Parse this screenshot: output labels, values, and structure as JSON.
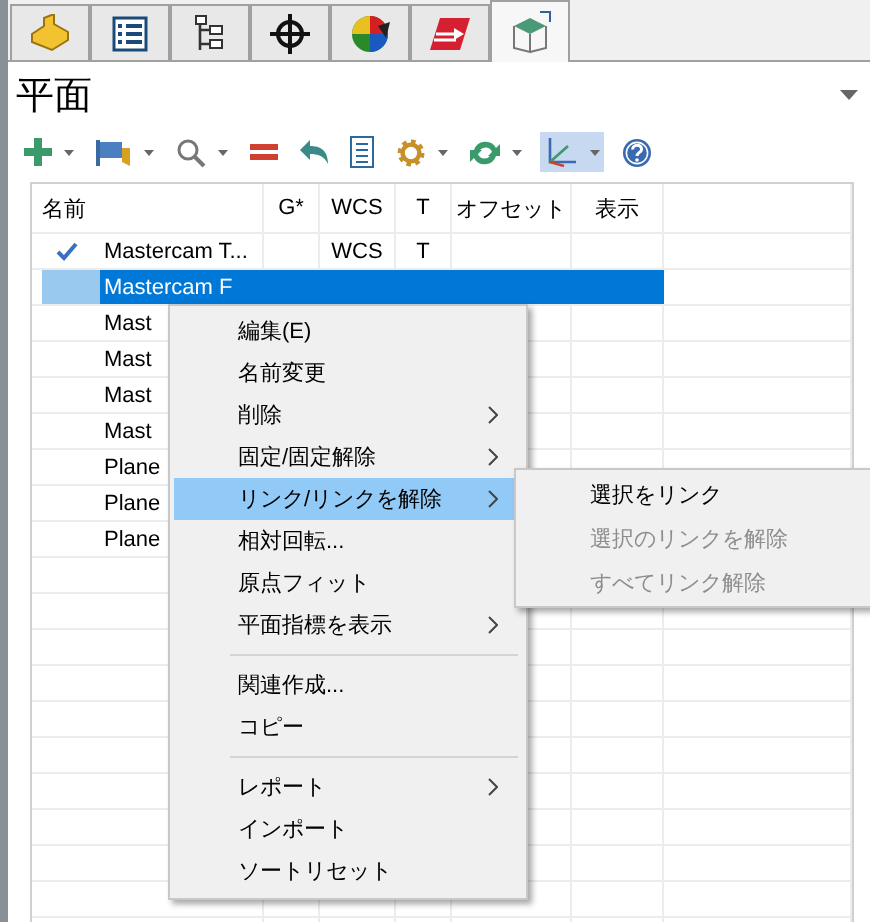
{
  "tabs": [
    {
      "kind": "block",
      "selected": false
    },
    {
      "kind": "list",
      "selected": false
    },
    {
      "kind": "tree",
      "selected": false
    },
    {
      "kind": "crosshair",
      "selected": false
    },
    {
      "kind": "ball",
      "selected": false
    },
    {
      "kind": "logo",
      "selected": false
    },
    {
      "kind": "plane",
      "selected": true
    }
  ],
  "panel": {
    "title": "平面"
  },
  "toolbar": [
    {
      "kind": "add",
      "dropdown": true,
      "active": false
    },
    {
      "kind": "flag",
      "dropdown": true,
      "active": false
    },
    {
      "kind": "search",
      "dropdown": true,
      "active": false
    },
    {
      "kind": "equals",
      "dropdown": false,
      "active": false
    },
    {
      "kind": "undo",
      "dropdown": false,
      "active": false
    },
    {
      "kind": "document",
      "dropdown": false,
      "active": false
    },
    {
      "kind": "gear",
      "dropdown": true,
      "active": false
    },
    {
      "kind": "refresh",
      "dropdown": true,
      "active": false
    },
    {
      "kind": "axes",
      "dropdown": true,
      "active": true
    },
    {
      "kind": "help",
      "dropdown": false,
      "active": false
    }
  ],
  "table": {
    "columns": [
      "名前",
      "G*",
      "WCS",
      "T",
      "オフセット",
      "表示"
    ],
    "rows": [
      {
        "current": true,
        "selected": false,
        "name": "Mastercam T...",
        "g": "",
        "wcs": "WCS",
        "t": "T",
        "offset": "",
        "display": ""
      },
      {
        "current": false,
        "selected": true,
        "name": "Mastercam F",
        "g": "",
        "wcs": "",
        "t": "",
        "offset": "",
        "display": ""
      },
      {
        "current": false,
        "selected": false,
        "name": "Mast",
        "g": "",
        "wcs": "",
        "t": "",
        "offset": "",
        "display": ""
      },
      {
        "current": false,
        "selected": false,
        "name": "Mast",
        "g": "",
        "wcs": "",
        "t": "",
        "offset": "",
        "display": ""
      },
      {
        "current": false,
        "selected": false,
        "name": "Mast",
        "g": "",
        "wcs": "",
        "t": "",
        "offset": "",
        "display": ""
      },
      {
        "current": false,
        "selected": false,
        "name": "Mast",
        "g": "",
        "wcs": "",
        "t": "",
        "offset": "",
        "display": ""
      },
      {
        "current": false,
        "selected": false,
        "name": "Plane",
        "g": "",
        "wcs": "",
        "t": "",
        "offset": "",
        "display": ""
      },
      {
        "current": false,
        "selected": false,
        "name": "Plane",
        "g": "",
        "wcs": "",
        "t": "",
        "offset": "",
        "display": ""
      },
      {
        "current": false,
        "selected": false,
        "name": "Plane",
        "g": "",
        "wcs": "",
        "t": "",
        "offset": "",
        "display": ""
      }
    ]
  },
  "context_menu": {
    "items": [
      {
        "kind": "item",
        "label": "編集(E)",
        "submenu": false,
        "highlighted": false
      },
      {
        "kind": "item",
        "label": "名前変更",
        "submenu": false,
        "highlighted": false
      },
      {
        "kind": "item",
        "label": "削除",
        "submenu": true,
        "highlighted": false
      },
      {
        "kind": "item",
        "label": "固定/固定解除",
        "submenu": true,
        "highlighted": false
      },
      {
        "kind": "item",
        "label": "リンク/リンクを解除",
        "submenu": true,
        "highlighted": true
      },
      {
        "kind": "item",
        "label": "相対回転...",
        "submenu": false,
        "highlighted": false
      },
      {
        "kind": "item",
        "label": "原点フィット",
        "submenu": false,
        "highlighted": false
      },
      {
        "kind": "item",
        "label": "平面指標を表示",
        "submenu": true,
        "highlighted": false
      },
      {
        "kind": "separator"
      },
      {
        "kind": "item",
        "label": "関連作成...",
        "submenu": false,
        "highlighted": false
      },
      {
        "kind": "item",
        "label": "コピー",
        "submenu": false,
        "highlighted": false
      },
      {
        "kind": "separator"
      },
      {
        "kind": "item",
        "label": "レポート",
        "submenu": true,
        "highlighted": false
      },
      {
        "kind": "item",
        "label": "インポート",
        "submenu": false,
        "highlighted": false
      },
      {
        "kind": "item",
        "label": "ソートリセット",
        "submenu": false,
        "highlighted": false
      }
    ]
  },
  "submenu": {
    "items": [
      {
        "label": "選択をリンク",
        "disabled": false
      },
      {
        "label": "選択のリンクを解除",
        "disabled": true
      },
      {
        "label": "すべてリンク解除",
        "disabled": true
      }
    ]
  }
}
